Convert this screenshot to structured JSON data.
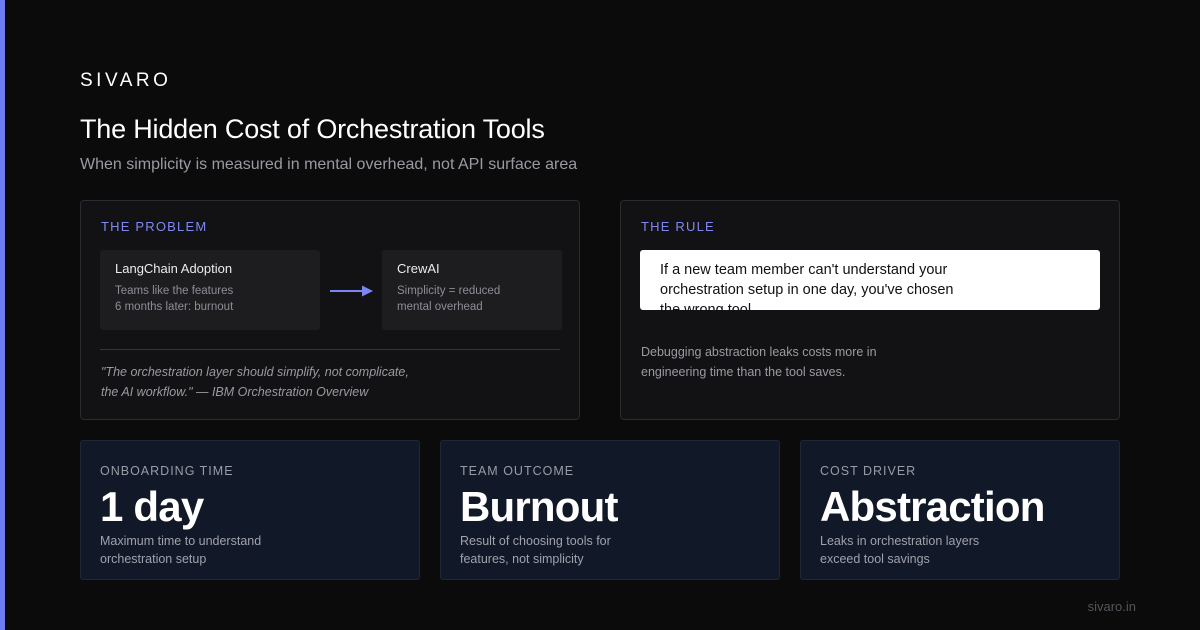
{
  "brand": "SIVARO",
  "title": "The Hidden Cost of Orchestration Tools",
  "subtitle": "When simplicity is measured in mental overhead, not API surface area",
  "colors": {
    "accent": "#6f7cf2",
    "background": "#0b0b0c",
    "stat_card": "#111827"
  },
  "problem": {
    "heading": "THE PROBLEM",
    "card_a": {
      "title": "LangChain Adoption",
      "lines": [
        "Teams like the features",
        "6 months later: burnout"
      ]
    },
    "arrow_icon": "arrow-right-icon",
    "card_b": {
      "title": "CrewAI",
      "lines": [
        "Simplicity = reduced",
        "mental overhead"
      ]
    },
    "quote_lines": [
      "\"The orchestration layer should simplify, not complicate,",
      "the AI workflow.\" — IBM Orchestration Overview"
    ]
  },
  "rule": {
    "heading": "THE RULE",
    "statement_lines": [
      "If a new team member can't understand your",
      "orchestration setup in one day, you've chosen",
      "the wrong tool."
    ],
    "note_lines": [
      "Debugging abstraction leaks costs more in",
      "engineering time than the tool saves."
    ]
  },
  "stats": [
    {
      "label": "ONBOARDING TIME",
      "value": "1 day",
      "desc_lines": [
        "Maximum time to understand",
        "orchestration setup"
      ]
    },
    {
      "label": "TEAM OUTCOME",
      "value": "Burnout",
      "desc_lines": [
        "Result of choosing tools for",
        "features, not simplicity"
      ]
    },
    {
      "label": "COST DRIVER",
      "value": "Abstraction",
      "desc_lines": [
        "Leaks in orchestration layers",
        "exceed tool savings"
      ]
    }
  ],
  "footer": "sivaro.in"
}
